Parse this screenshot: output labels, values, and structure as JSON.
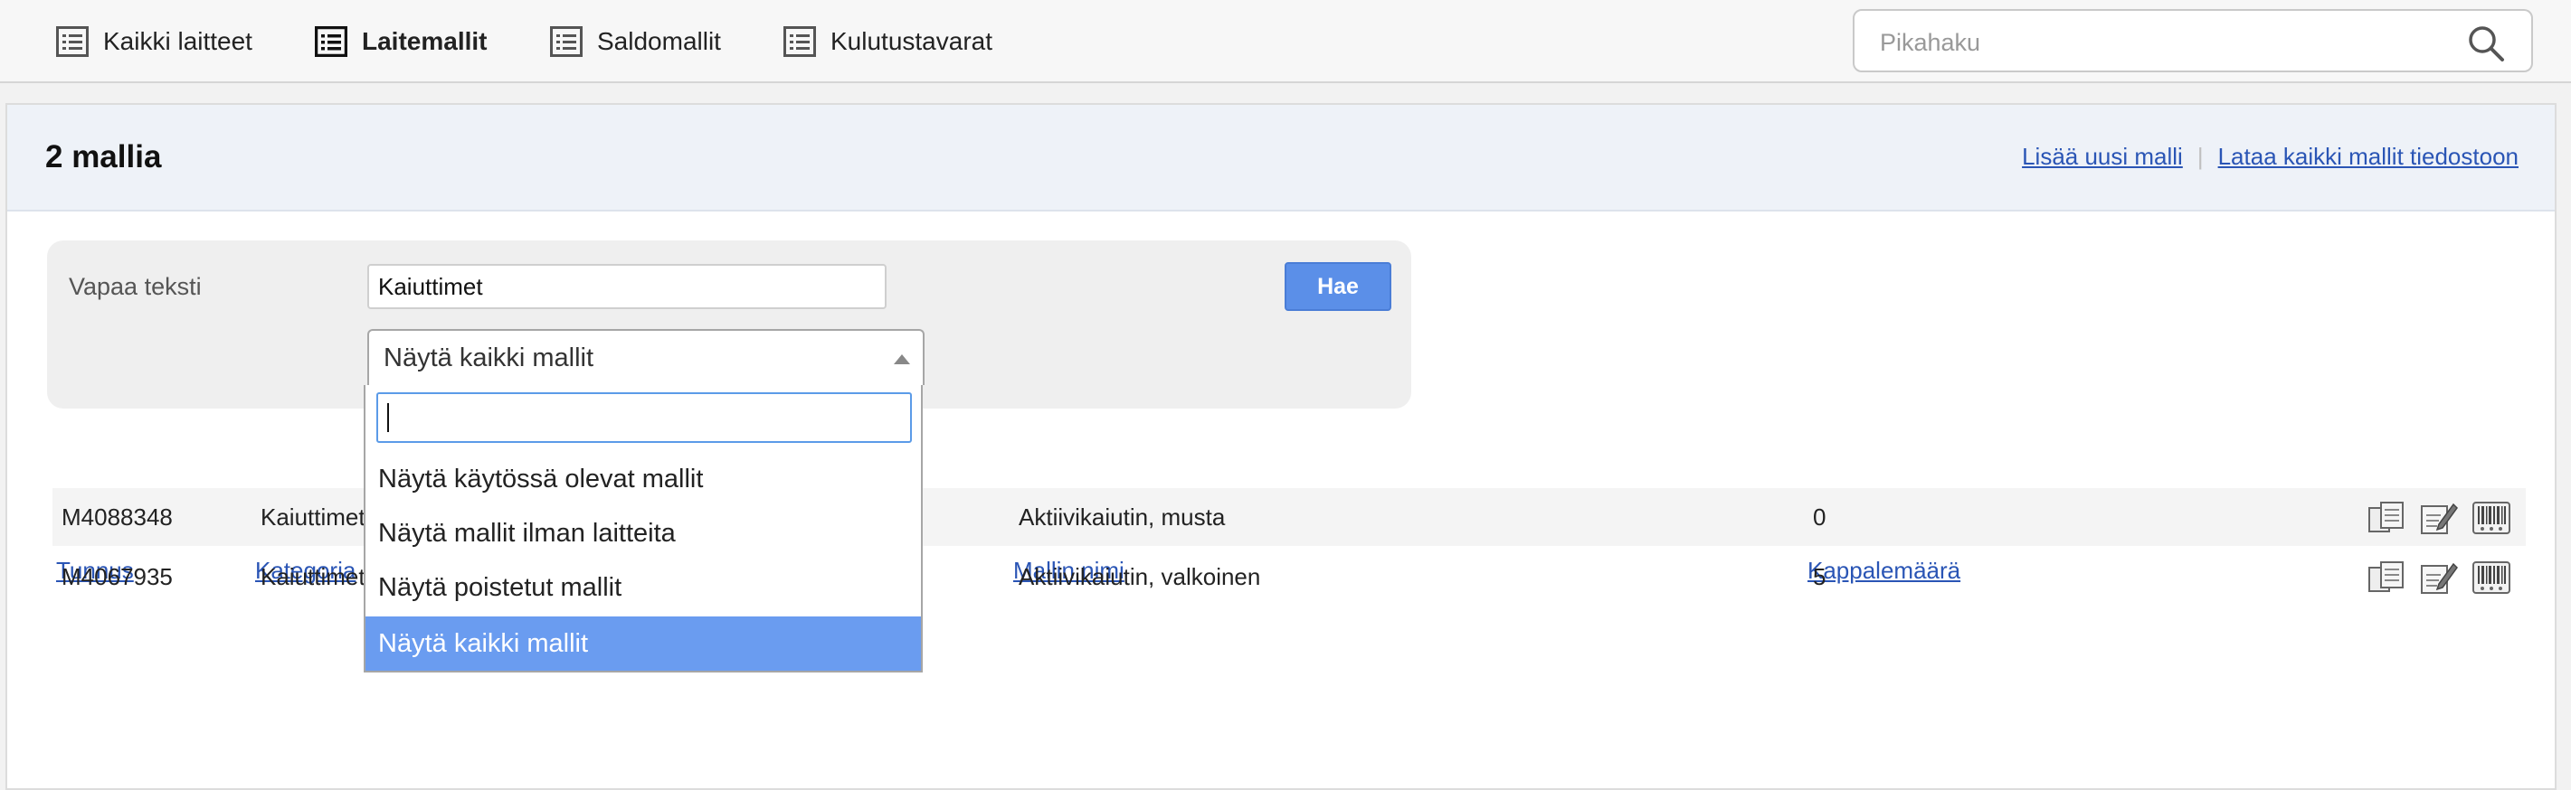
{
  "nav": {
    "items": [
      {
        "label": "Kaikki laitteet",
        "active": false,
        "icon": "list-icon"
      },
      {
        "label": "Laitemallit",
        "active": true,
        "icon": "list-icon"
      },
      {
        "label": "Saldomallit",
        "active": false,
        "icon": "list-icon"
      },
      {
        "label": "Kulutustavarat",
        "active": false,
        "icon": "list-icon"
      }
    ],
    "search": {
      "placeholder": "Pikahaku",
      "value": "",
      "icon": "search-icon"
    }
  },
  "header": {
    "title": "2 mallia",
    "links": [
      "Lisää uusi malli",
      "Lataa kaikki mallit tiedostoon"
    ]
  },
  "filter": {
    "label": "Vapaa teksti",
    "text_value": "Kaiuttimet",
    "search_button": "Hae",
    "select_value": "Näytä kaikki mallit",
    "dropdown_search_value": "",
    "options": [
      "Näytä käytössä olevat mallit",
      "Näytä mallit ilman laitteita",
      "Näytä poistetut mallit",
      "Näytä kaikki mallit"
    ],
    "selected_option": "Näytä kaikki mallit"
  },
  "table": {
    "headers": [
      "Tunnus",
      "Kategoria",
      "Mallin nimi",
      "Kappalemäärä"
    ],
    "rows": [
      {
        "tunnus": "M4088348",
        "kategoria": "Kaiuttimet",
        "nimi": "Aktiivikaiutin, musta",
        "maara": "0"
      },
      {
        "tunnus": "M4067935",
        "kategoria": "Kaiuttimet",
        "nimi": "Aktiivikaiutin, valkoinen",
        "maara": "5"
      }
    ],
    "row_actions": [
      "copy-icon",
      "edit-icon",
      "barcode-icon"
    ]
  },
  "colors": {
    "link": "#2a55b5",
    "button": "#5b8fe8",
    "selected_option": "#6a9cf0",
    "header_bg": "#eef2f8"
  }
}
